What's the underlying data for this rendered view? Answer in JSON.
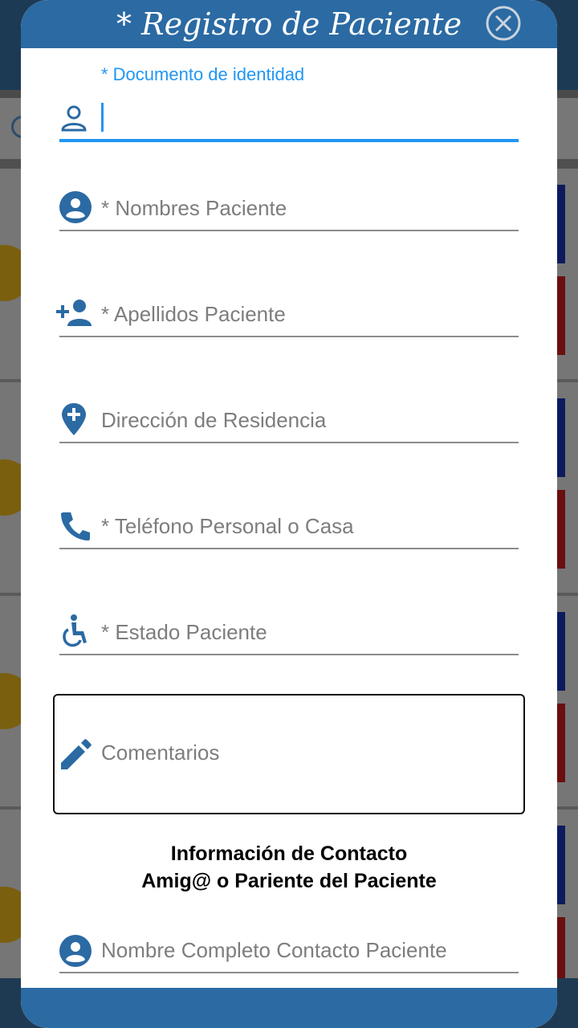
{
  "dialog": {
    "title": "* Registro de Paciente",
    "close_icon": "close-circle-icon"
  },
  "fields": {
    "document": {
      "label": "* Documento de identidad",
      "value": "",
      "icon": "person-outline-icon"
    },
    "names": {
      "placeholder": "* Nombres Paciente",
      "icon": "account-circle-icon"
    },
    "surnames": {
      "placeholder": "* Apellidos Paciente",
      "icon": "person-add-icon"
    },
    "address": {
      "placeholder": "Dirección de Residencia",
      "icon": "location-plus-icon"
    },
    "phone": {
      "placeholder": "* Teléfono Personal o Casa",
      "icon": "phone-icon"
    },
    "status": {
      "placeholder": "* Estado Paciente",
      "icon": "accessible-icon"
    },
    "comments": {
      "placeholder": "Comentarios",
      "icon": "pencil-icon"
    },
    "contact_name": {
      "placeholder": "Nombre Completo Contacto Paciente",
      "icon": "account-circle-icon"
    }
  },
  "contact_section": {
    "line1": "Información de Contacto",
    "line2": "Amig@ o Pariente del Paciente"
  },
  "colors": {
    "header": "#2b6aa3",
    "accent": "#2196f3",
    "icon": "#2b6aa3"
  }
}
